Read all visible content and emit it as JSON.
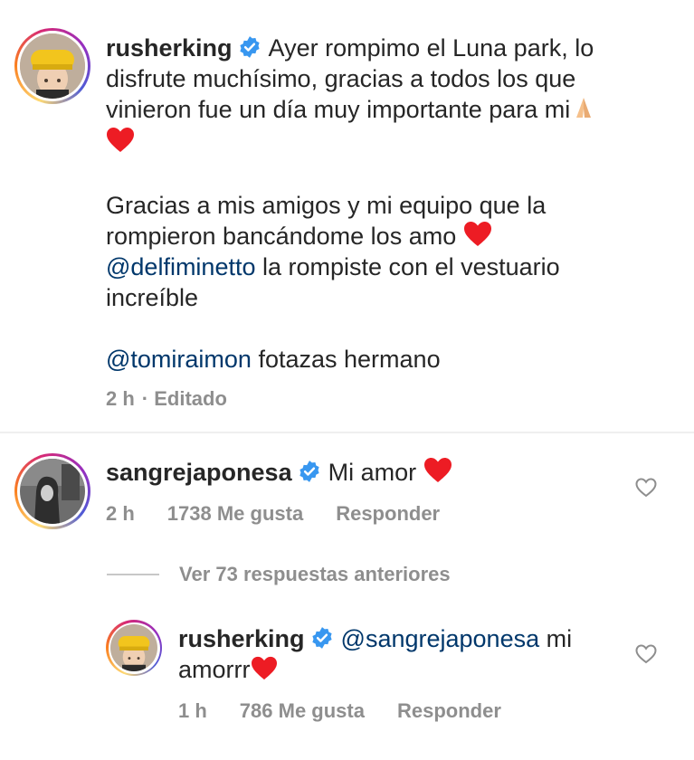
{
  "post": {
    "username": "rusherking",
    "line1": "Ayer rompimo el Luna park, lo",
    "line2": "disfrute muchísimo, gracias a todos los que",
    "line3": "vinieron fue un día muy importante para mi",
    "para2_line1": "Gracias a mis amigos y mi equipo que la",
    "para2_line2": "rompieron bancándome los amo",
    "mention1": "@delfiminetto",
    "mention1_text": "la rompiste con el vestuario",
    "para2_line4": "increíble",
    "mention2": "@tomiraimon",
    "mention2_text": "fotazas hermano",
    "time": "2 h",
    "edited": "· Editado"
  },
  "comment": {
    "username": "sangrejaponesa",
    "text": "Mi amor",
    "time": "2 h",
    "likes": "1738 Me gusta",
    "reply": "Responder"
  },
  "view_replies": "Ver 73 respuestas anteriores",
  "reply": {
    "username": "rusherking",
    "mention": "@sangrejaponesa",
    "text_end": "mi",
    "line2": "amorrr",
    "time": "1 h",
    "likes": "786 Me gusta",
    "reply": "Responder"
  },
  "colors": {
    "verified": "#3897f0",
    "mention": "#00376b",
    "heart": "#ed1c24",
    "meta": "#8e8e8e"
  },
  "icons": [
    "verified-badge-icon",
    "heart-emoji-icon",
    "praying-hands-emoji-icon",
    "like-heart-outline-icon"
  ]
}
